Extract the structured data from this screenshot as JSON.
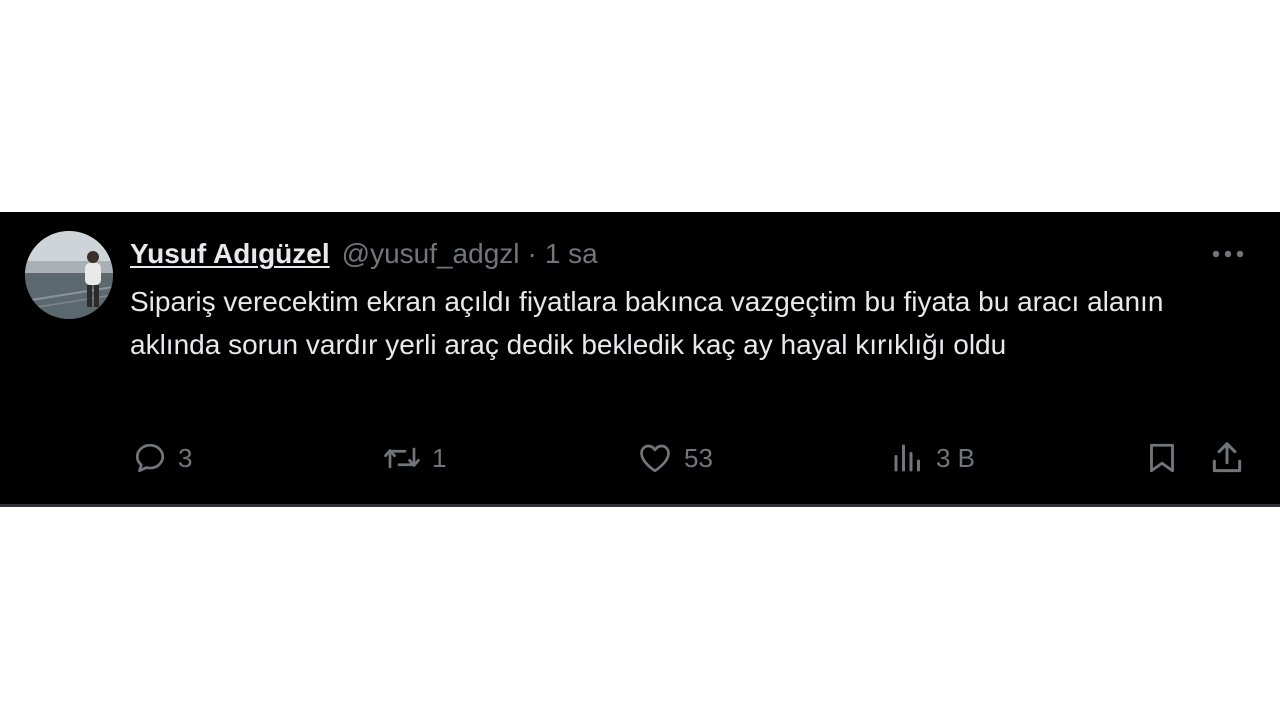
{
  "tweet": {
    "author_name": "Yusuf Adıgüzel",
    "author_handle": "@yusuf_adgzl",
    "separator": "·",
    "time": "1 sa",
    "text": "Sipariş verecektim ekran açıldı fiyatlara bakınca vazgeçtim bu fiyata bu aracı alanın aklında sorun vardır yerli araç dedik bekledik kaç ay hayal kırıklığı oldu",
    "more_icon": "more-horizontal-icon"
  },
  "actions": {
    "reply": {
      "icon": "reply-icon",
      "count": "3"
    },
    "repost": {
      "icon": "repost-icon",
      "count": "1"
    },
    "like": {
      "icon": "heart-icon",
      "count": "53"
    },
    "views": {
      "icon": "views-icon",
      "count": "3 B"
    },
    "bookmark": {
      "icon": "bookmark-icon"
    },
    "share": {
      "icon": "share-icon"
    }
  },
  "colors": {
    "background": "#000000",
    "text_primary": "#e7e9ea",
    "text_secondary": "#71767b",
    "page_background": "#ffffff"
  }
}
